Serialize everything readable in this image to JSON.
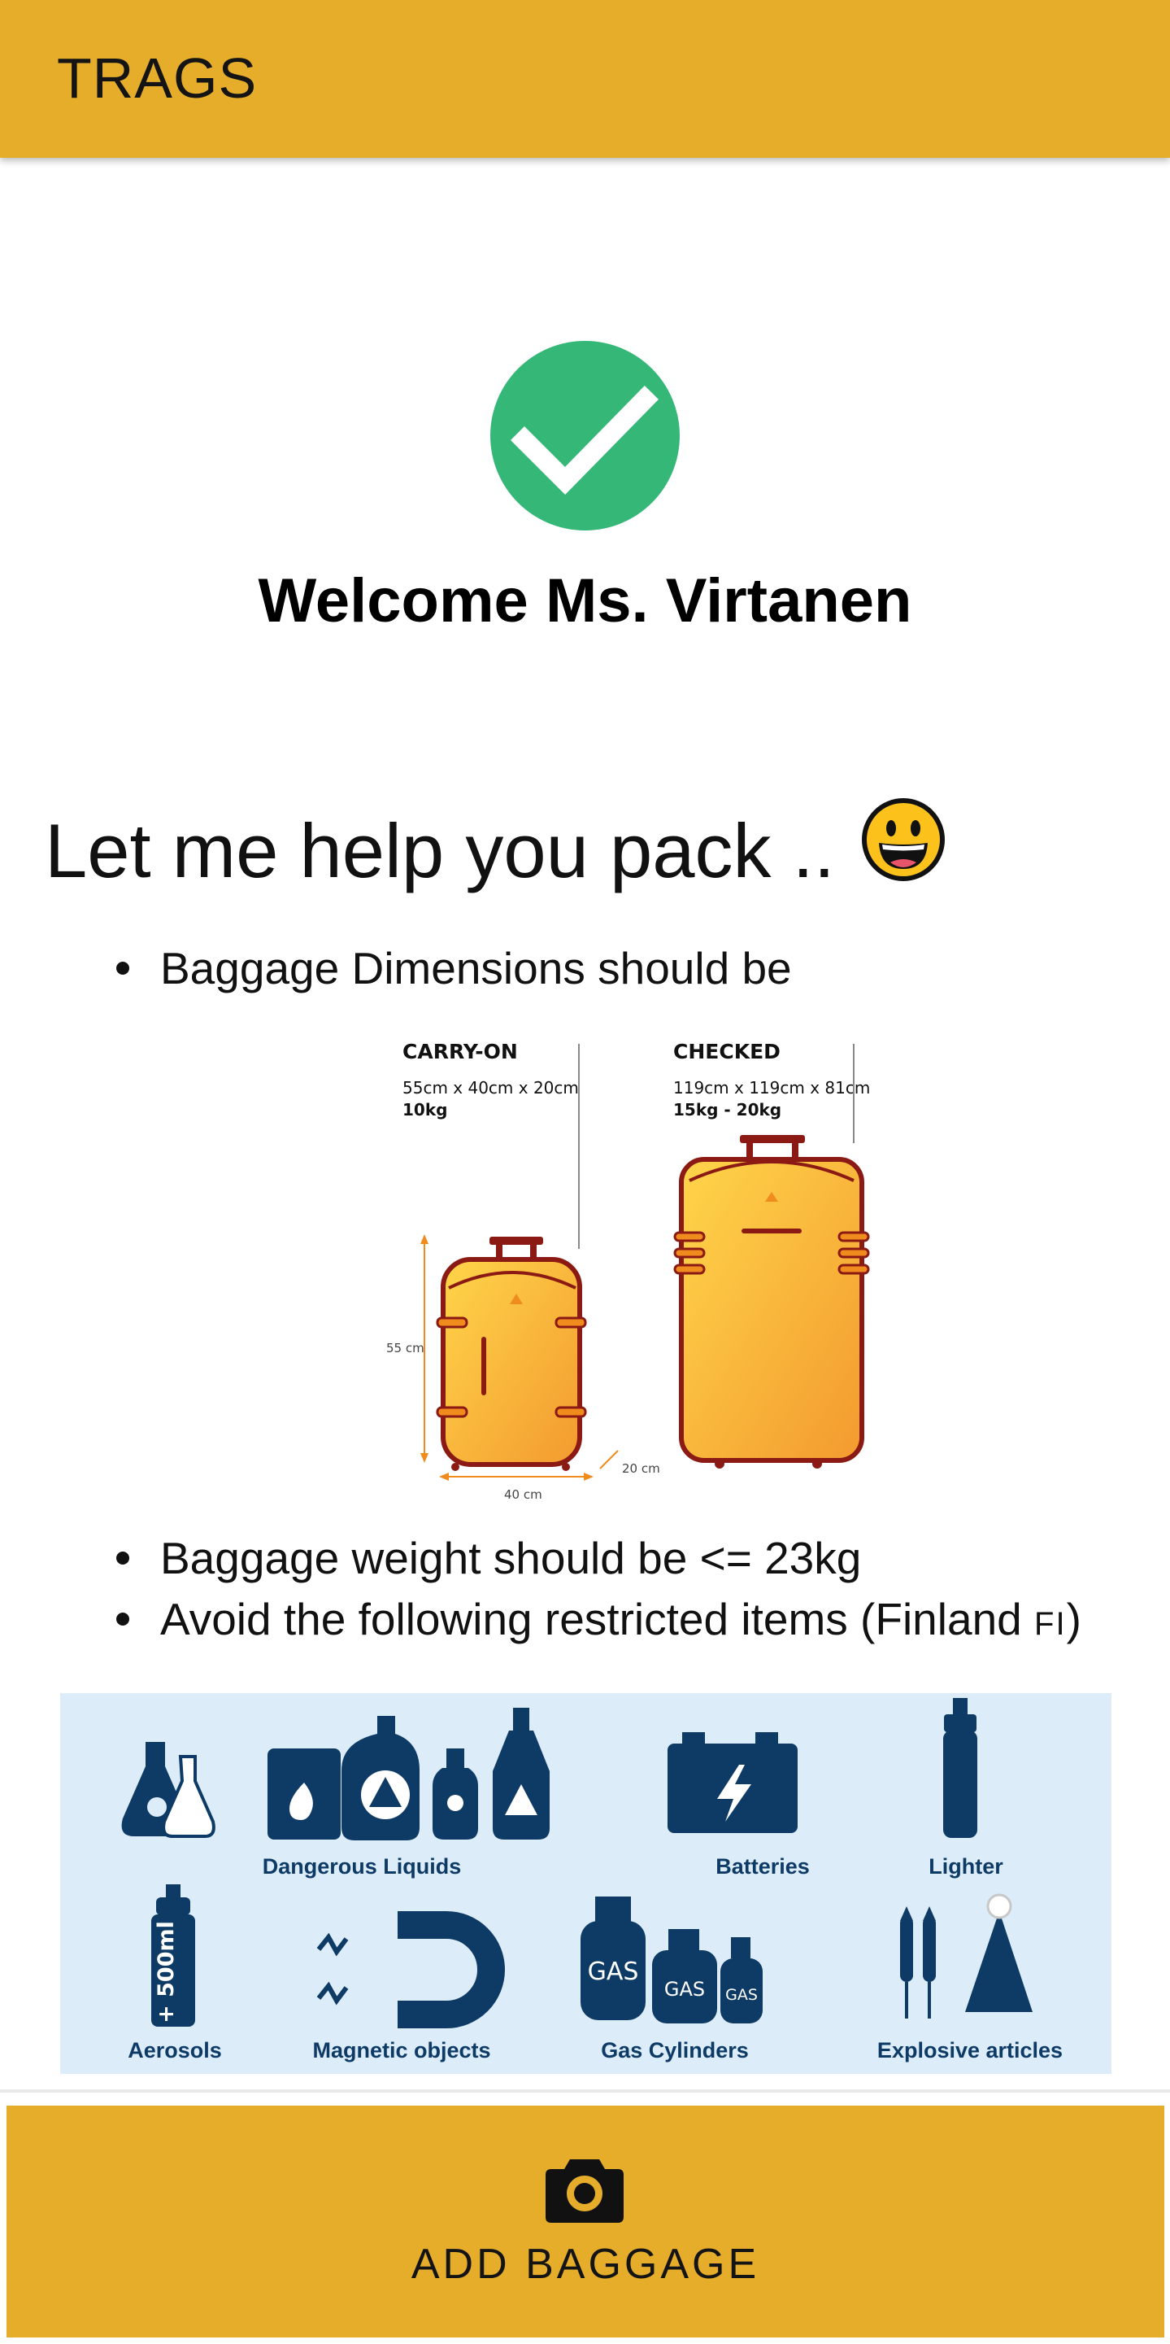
{
  "app": {
    "title": "TRAGS"
  },
  "welcome": {
    "text": "Welcome Ms. Virtanen"
  },
  "help": {
    "heading": "Let me help you pack .."
  },
  "tips": {
    "dimensions": "Baggage Dimensions should be",
    "weight": "Baggage weight should be <= 23kg",
    "restricted": "Avoid the following restricted items (Finland ",
    "restricted_flag": "FI",
    "restricted_close": ")"
  },
  "baggage": {
    "carry_on": {
      "title": "CARRY-ON",
      "dims": "55cm x 40cm x 20cm",
      "weight": "10kg",
      "height_label": "55 cm",
      "width_label": "40 cm",
      "depth_label": "20 cm"
    },
    "checked": {
      "title": "CHECKED",
      "dims": "119cm x 119cm x 81cm",
      "weight": "15kg - 20kg"
    }
  },
  "restricted_items": [
    {
      "label": "Dangerous Liquids",
      "icon": "dangerous-liquids-icon"
    },
    {
      "label": "Batteries",
      "icon": "battery-icon"
    },
    {
      "label": "Lighter",
      "icon": "lighter-icon"
    },
    {
      "label": "Aerosols",
      "icon": "aerosol-icon"
    },
    {
      "label": "Magnetic objects",
      "icon": "magnet-icon"
    },
    {
      "label": "Gas Cylinders",
      "icon": "gas-cylinder-icon"
    },
    {
      "label": "Explosive articles",
      "icon": "explosive-icon"
    }
  ],
  "aerosol_text": "+ 500ml",
  "gas_text": "GAS",
  "actions": {
    "add_baggage": "ADD BAGGAGE"
  },
  "colors": {
    "primary": "#e6ad2b",
    "success": "#35b777",
    "restricted_bg": "#dcedf9",
    "icon_navy": "#0e3a66"
  }
}
